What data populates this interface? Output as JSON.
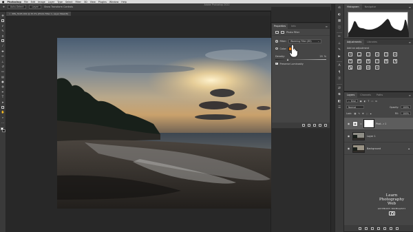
{
  "menubar": {
    "app": "Photoshop",
    "items": [
      "File",
      "Edit",
      "Image",
      "Layer",
      "Type",
      "Select",
      "Filter",
      "3D",
      "View",
      "Plugins",
      "Window",
      "Help"
    ],
    "window_title": "Adobe Photoshop 2022"
  },
  "options_bar": {
    "tool_preset": "Auto-Select",
    "layer_mode": "Layer",
    "show_transform": "Show Transform Controls"
  },
  "document_tab": {
    "title": "IMG_5125.CR2 @ 33.3% (Photo Filter 1, Layer Mask/8)",
    "close": "×"
  },
  "properties": {
    "tabs": [
      "Properties",
      "Info"
    ],
    "active_tab": "Properties",
    "header_label": "Photo Filter",
    "filter_label": "Filter:",
    "filter_value": "Warming Filter (85)",
    "color_label": "Color:",
    "color_hex": "#e87b12",
    "density_label": "Density:",
    "density_value": "25",
    "density_unit": "%",
    "density_fraction": 0.25,
    "preserve_luminosity": "Preserve Luminosity"
  },
  "histogram_panel": {
    "tabs": [
      "Histogram",
      "Navigator"
    ]
  },
  "adjustments_panel": {
    "tabs": [
      "Adjustments",
      "Libraries"
    ],
    "title": "Add an adjustment",
    "icons": [
      "brightness-contrast-icon",
      "levels-icon",
      "curves-icon",
      "exposure-icon",
      "vibrance-icon",
      "hue-saturation-icon",
      "color-balance-icon",
      "black-white-icon",
      "photo-filter-icon",
      "channel-mixer-icon",
      "color-lookup-icon",
      "invert-icon",
      "posterize-icon",
      "threshold-icon",
      "gradient-map-icon",
      "selective-color-icon"
    ]
  },
  "layers_panel": {
    "tabs": [
      "Layers",
      "Channels",
      "Paths"
    ],
    "filter_kind": "Kind",
    "blend_mode": "Normal",
    "opacity_label": "Opacity:",
    "opacity_value": "100%",
    "lock_label": "Lock:",
    "fill_label": "Fill:",
    "fill_value": "100%",
    "layers": [
      {
        "name": "Phot...r 1",
        "selected": true,
        "type": "adjustment"
      },
      {
        "name": "Layer 1",
        "selected": false,
        "type": "pixel"
      },
      {
        "name": "Background",
        "selected": false,
        "type": "pixel",
        "locked": true
      }
    ]
  },
  "watermark": {
    "line1": "Learn",
    "line2": "Photography",
    "line3": "Web",
    "line4": "ANTHONY MORGANTI"
  }
}
